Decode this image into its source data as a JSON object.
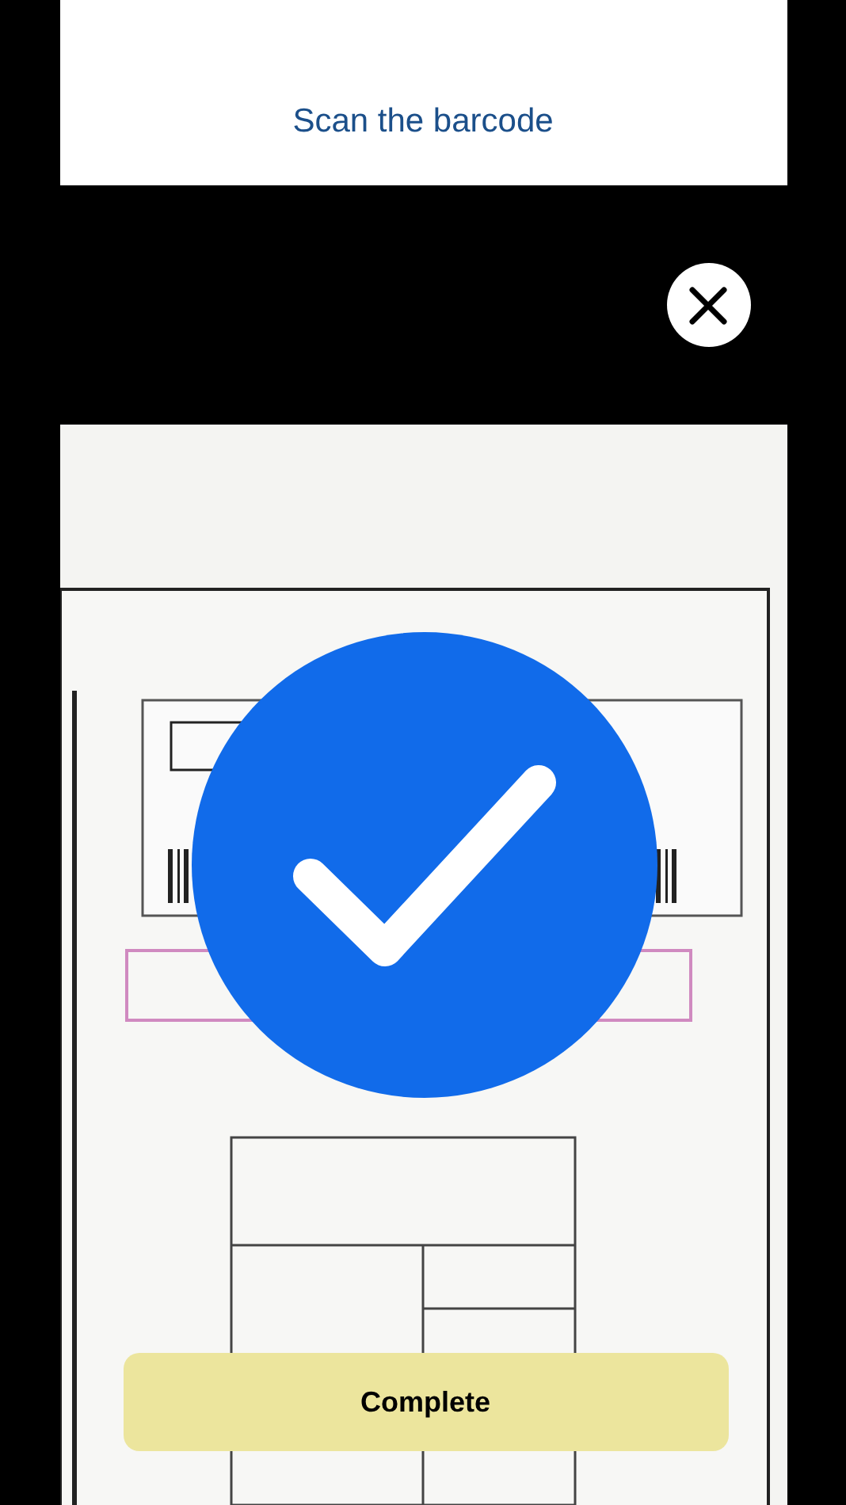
{
  "header": {
    "title": "Scan the barcode"
  },
  "camera": {
    "kind": "picture",
    "scanned": true
  },
  "complete_button": {
    "label": "Complete"
  }
}
